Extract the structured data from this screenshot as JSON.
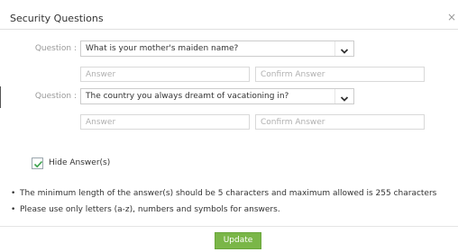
{
  "dialog": {
    "title": "Security Questions",
    "close_glyph": "×"
  },
  "questions": [
    {
      "label": "Question :",
      "selected": "What is your mother's maiden name?",
      "answer_placeholder": "Answer",
      "confirm_placeholder": "Confirm Answer"
    },
    {
      "label": "Question :",
      "selected": "The country you always dreamt of vacationing in?",
      "answer_placeholder": "Answer",
      "confirm_placeholder": "Confirm Answer"
    }
  ],
  "hide_answers": {
    "label": "Hide Answer(s)",
    "checked": true
  },
  "notes": [
    "The minimum length of the answer(s) should be 5 characters and maximum allowed is 255 characters",
    "Please use only letters (a-z), numbers and symbols for answers."
  ],
  "note_bullet": "•",
  "footer": {
    "update_label": "Update"
  },
  "colors": {
    "accent_green": "#7ab648",
    "checkmark_green": "#3aa14b",
    "label_gray": "#999999"
  },
  "icons": {
    "close": "close-icon",
    "dropdown": "chevron-down-icon",
    "check": "checkmark-icon"
  }
}
